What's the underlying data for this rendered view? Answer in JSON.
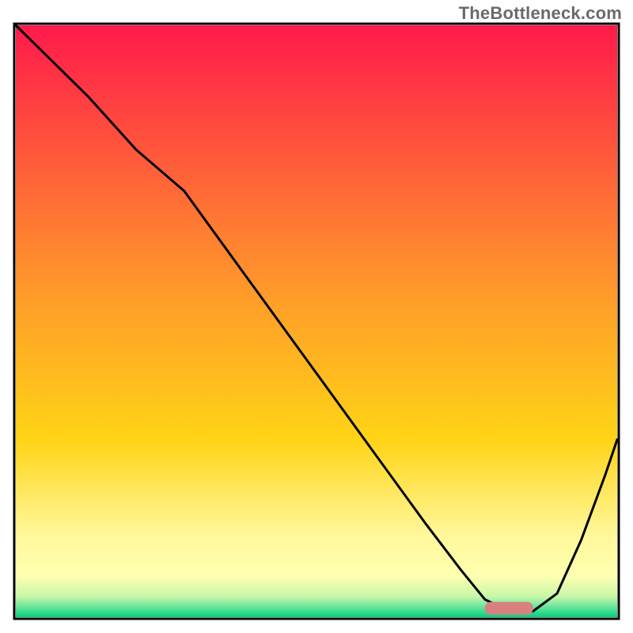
{
  "watermark": "TheBottleneck.com",
  "chart_data": {
    "type": "line",
    "title": "",
    "xlabel": "",
    "ylabel": "",
    "xlim": [
      0,
      100
    ],
    "ylim": [
      0,
      100
    ],
    "grid": false,
    "legend": false,
    "background_gradient": {
      "stops": [
        {
          "offset": 0.0,
          "color": "#ff1a4b"
        },
        {
          "offset": 0.45,
          "color": "#ff9a2a"
        },
        {
          "offset": 0.7,
          "color": "#ffd416"
        },
        {
          "offset": 0.86,
          "color": "#fff79a"
        },
        {
          "offset": 0.93,
          "color": "#ffffb0"
        },
        {
          "offset": 0.965,
          "color": "#c8f7a8"
        },
        {
          "offset": 0.985,
          "color": "#5be29a"
        },
        {
          "offset": 1.0,
          "color": "#00d27a"
        }
      ]
    },
    "series": [
      {
        "name": "bottleneck-curve",
        "color": "#000000",
        "x": [
          0,
          4,
          12,
          20,
          28,
          38,
          48,
          58,
          68,
          74,
          78,
          82,
          86,
          90,
          94,
          98,
          100
        ],
        "y": [
          100,
          96,
          88,
          79,
          72,
          58,
          44,
          30,
          16,
          8,
          3,
          1,
          1,
          4,
          13,
          24,
          30
        ]
      }
    ],
    "marker": {
      "name": "optimal-range",
      "x_start": 78,
      "x_end": 86,
      "y": 1.5,
      "color": "#d98080"
    }
  }
}
